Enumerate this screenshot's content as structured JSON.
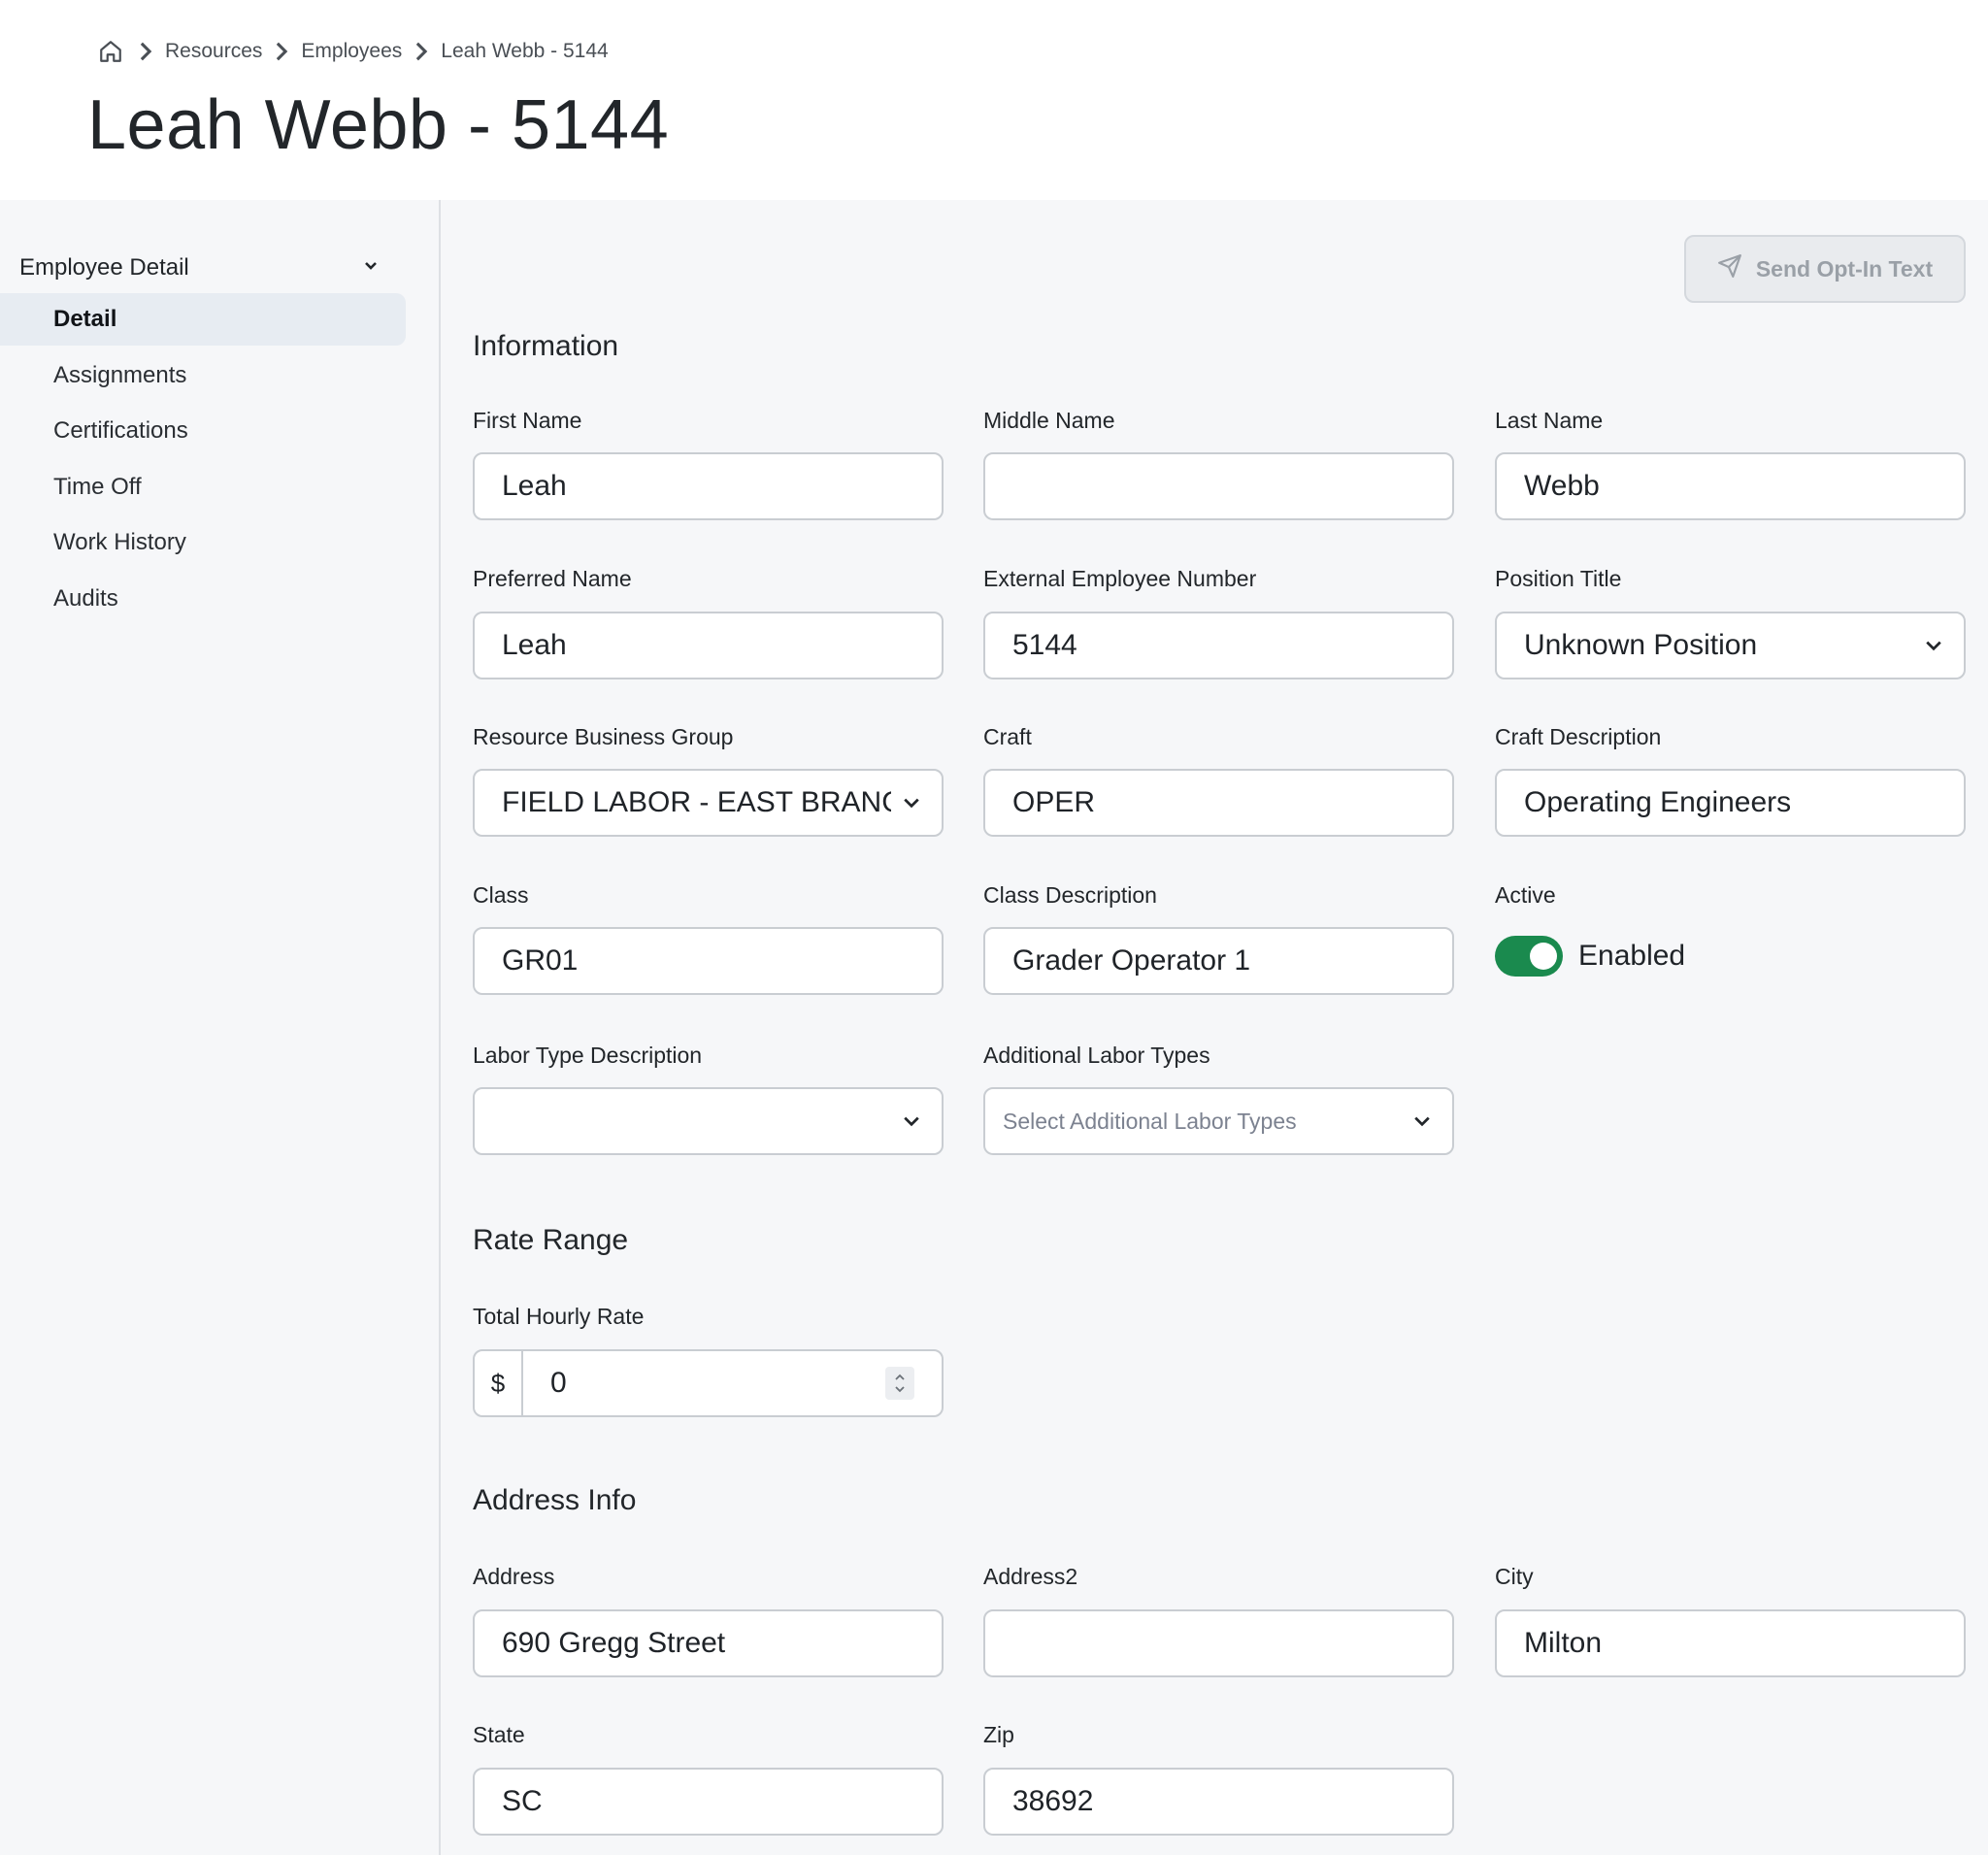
{
  "breadcrumb": {
    "items": [
      "Resources",
      "Employees",
      "Leah Webb - 5144"
    ]
  },
  "page_title": "Leah Webb - 5144",
  "sidebar": {
    "group_label": "Employee Detail",
    "items": [
      {
        "label": "Detail",
        "active": true
      },
      {
        "label": "Assignments",
        "active": false
      },
      {
        "label": "Certifications",
        "active": false
      },
      {
        "label": "Time Off",
        "active": false
      },
      {
        "label": "Work History",
        "active": false
      },
      {
        "label": "Audits",
        "active": false
      }
    ]
  },
  "actions": {
    "send_opt_in_label": "Send Opt-In Text"
  },
  "information": {
    "title": "Information",
    "first_name": {
      "label": "First Name",
      "value": "Leah"
    },
    "middle_name": {
      "label": "Middle Name",
      "value": ""
    },
    "last_name": {
      "label": "Last Name",
      "value": "Webb"
    },
    "preferred_name": {
      "label": "Preferred Name",
      "value": "Leah"
    },
    "external_employee_number": {
      "label": "External Employee Number",
      "value": "5144"
    },
    "position_title": {
      "label": "Position Title",
      "value": "Unknown Position"
    },
    "resource_business_group": {
      "label": "Resource Business Group",
      "value": "FIELD LABOR - EAST BRANCH"
    },
    "craft": {
      "label": "Craft",
      "value": "OPER"
    },
    "craft_description": {
      "label": "Craft Description",
      "value": "Operating Engineers"
    },
    "class": {
      "label": "Class",
      "value": "GR01"
    },
    "class_description": {
      "label": "Class Description",
      "value": "Grader Operator 1"
    },
    "active": {
      "label": "Active",
      "state_text": "Enabled",
      "enabled": true
    },
    "labor_type_description": {
      "label": "Labor Type Description",
      "value": ""
    },
    "additional_labor_types": {
      "label": "Additional Labor Types",
      "placeholder": "Select Additional Labor Types"
    }
  },
  "rate_range": {
    "title": "Rate Range",
    "total_hourly_rate": {
      "label": "Total Hourly Rate",
      "prefix": "$",
      "value": "0"
    }
  },
  "address_info": {
    "title": "Address Info",
    "address": {
      "label": "Address",
      "value": "690 Gregg Street"
    },
    "address2": {
      "label": "Address2",
      "value": ""
    },
    "city": {
      "label": "City",
      "value": "Milton"
    },
    "state": {
      "label": "State",
      "value": "SC"
    },
    "zip": {
      "label": "Zip",
      "value": "38692"
    }
  },
  "colors": {
    "toggle_on": "#1a8a4e",
    "active_nav_bg": "#e7ecf2",
    "page_bg": "#f6f7f9"
  },
  "icons": {
    "home": "home-icon",
    "breadcrumb_separator": "chevron-right-icon",
    "group_toggle": "chevron-down-icon",
    "send": "paper-plane-icon",
    "select": "chevron-down-icon",
    "spinner": "spinner-arrows-icon"
  }
}
